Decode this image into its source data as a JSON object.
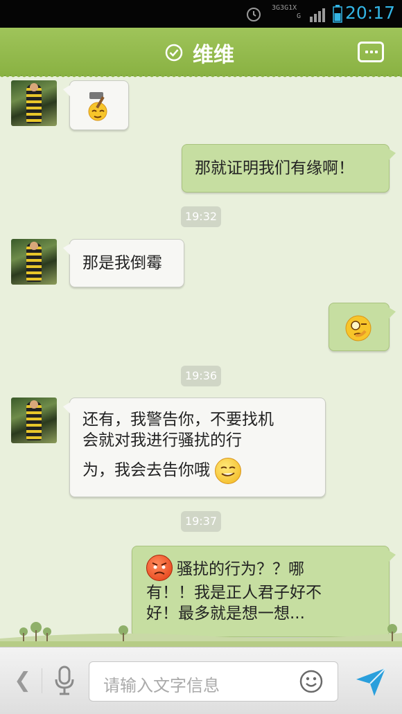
{
  "status_bar": {
    "time": "20:17",
    "network_labels": [
      "3G",
      "3G",
      "1X",
      "G"
    ]
  },
  "header": {
    "title": "维维",
    "accent_color": "#8ab243"
  },
  "messages": [
    {
      "side": "left",
      "type": "emoji",
      "emoji": "hammer-face-emoji"
    },
    {
      "side": "right",
      "type": "text",
      "text": "那就证明我们有缘啊！"
    },
    {
      "type": "timestamp",
      "text": "19:32"
    },
    {
      "side": "left",
      "type": "text",
      "text": "那是我倒霉"
    },
    {
      "side": "right",
      "type": "emoji",
      "emoji": "thinking-face-emoji"
    },
    {
      "type": "timestamp",
      "text": "19:36"
    },
    {
      "side": "left",
      "type": "text",
      "lines": [
        "还有，我警告你，不要找机",
        "会就对我进行骚扰的行",
        "为，我会去告你哦"
      ],
      "emoji": "smirk-face-emoji"
    },
    {
      "type": "timestamp",
      "text": "19:37"
    },
    {
      "side": "right",
      "type": "text",
      "emoji": "angry-face-emoji",
      "lines": [
        "骚扰的行为？？哪",
        "有！！我是正人君子好不",
        "好！最多就是想一想..."
      ]
    }
  ],
  "input": {
    "placeholder": "请输入文字信息"
  }
}
